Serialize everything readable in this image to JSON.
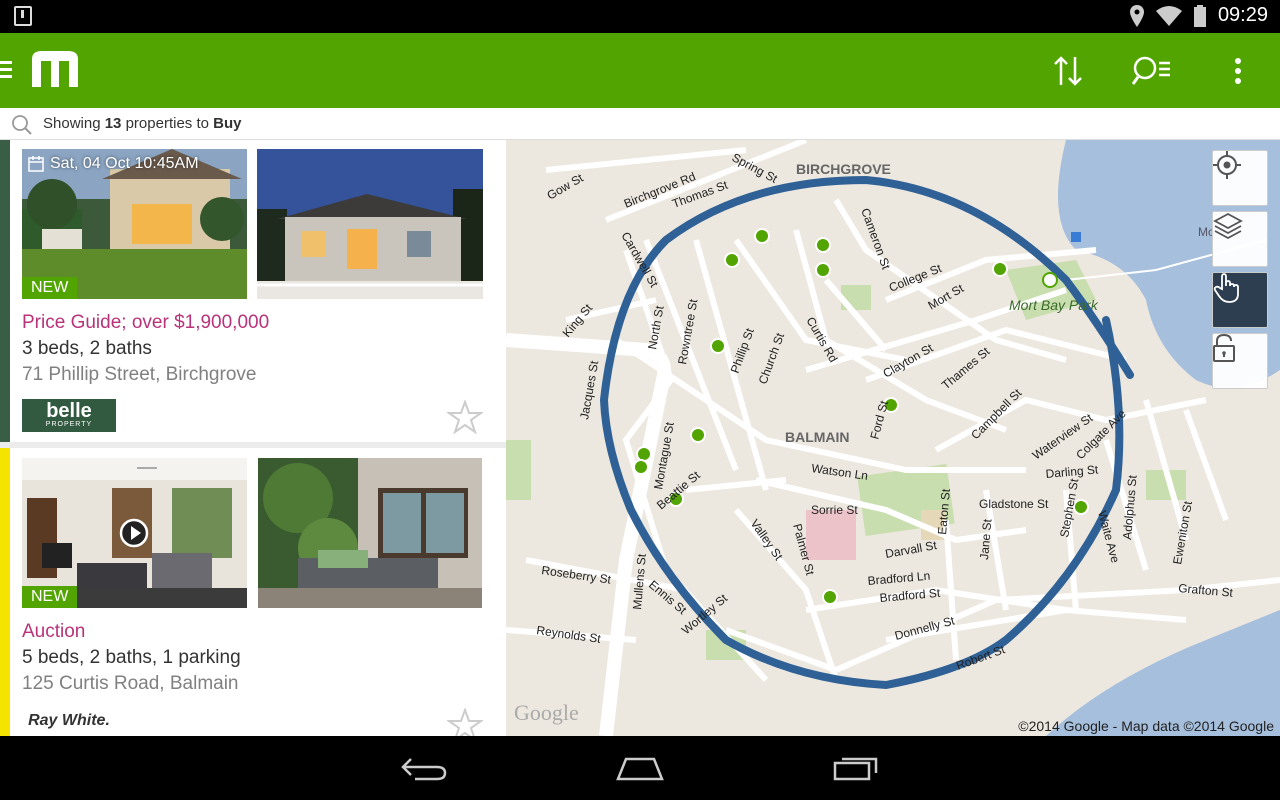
{
  "status": {
    "time": "09:29"
  },
  "toolbar": {
    "sort_icon": "sort-icon",
    "filter_icon": "filter-icon",
    "overflow_icon": "overflow-menu-icon"
  },
  "search": {
    "prefix": "Showing",
    "count": "13",
    "middle": "properties to",
    "mode": "Buy"
  },
  "listings": [
    {
      "date_label": "Sat, 04 Oct 10:45AM",
      "new_label": "NEW",
      "price": "Price Guide; over $1,900,000",
      "specs": "3 beds, 2 baths",
      "address": "71 Phillip Street, Birchgrove",
      "agency": "belle",
      "agency_sub": "PROPERTY",
      "accent": "#3a5e45"
    },
    {
      "new_label": "NEW",
      "price": "Auction",
      "specs": "5 beds, 2 baths, 1 parking",
      "address": "125 Curtis Road, Balmain",
      "agency": "Ray White.",
      "accent": "#f4e400"
    }
  ],
  "map": {
    "labels": {
      "birchgrove": "BIRCHGROVE",
      "balmain": "BALMAIN",
      "mort_bay_park": "Mort Bay Park",
      "mort": "Mort",
      "gow_st": "Gow St",
      "birchgrove_rd": "Birchgrove Rd",
      "thomas_st": "Thomas St",
      "spring_st": "Spring St",
      "cardwell_st": "Cardwell St",
      "cameron_st": "Cameron St",
      "college_st": "College St",
      "mort_st": "Mort St",
      "king_st": "King St",
      "north_st": "North St",
      "rowntree_st": "Rowntree St",
      "phillip_st": "Phillip St",
      "church_st": "Church St",
      "curtis_rd": "Curtis Rd",
      "clayton_st": "Clayton St",
      "thames_st": "Thames St",
      "jacques_st": "Jacques St",
      "ford_st": "Ford St",
      "campbell_st": "Campbell St",
      "waterview_st": "Waterview St",
      "colgate_ave": "Colgate Ave",
      "montague_st": "Montague St",
      "watson_ln": "Watson Ln",
      "darling_st": "Darling St",
      "beattie_st": "Beattie St",
      "sorrie_st": "Sorrie St",
      "eaton_st": "Eaton St",
      "gladstone_st": "Gladstone St",
      "stephen_st": "Stephen St",
      "waite_ave": "Waite Ave",
      "adolphus_st": "Adolphus St",
      "valley_st": "Valley St",
      "palmer_st": "Palmer St",
      "jane_st": "Jane St",
      "darvall_st": "Darvall St",
      "eventon_st": "Eweniton St",
      "roseberry_st": "Roseberry St",
      "mullens_st": "Mullens St",
      "ennis_st": "Ennis St",
      "bradford_ln": "Bradford Ln",
      "bradford_st": "Bradford St",
      "grafton_st": "Grafton St",
      "reynolds_st": "Reynolds St",
      "wortley_st": "Wortley St",
      "donnelly_st": "Donnelly St",
      "robert_st": "Robert St"
    },
    "google": "Google",
    "copyright": "©2014 Google - Map data ©2014 Google",
    "buttons": [
      "my-location-icon",
      "layers-icon",
      "draw-hand-icon",
      "unlock-icon"
    ]
  }
}
